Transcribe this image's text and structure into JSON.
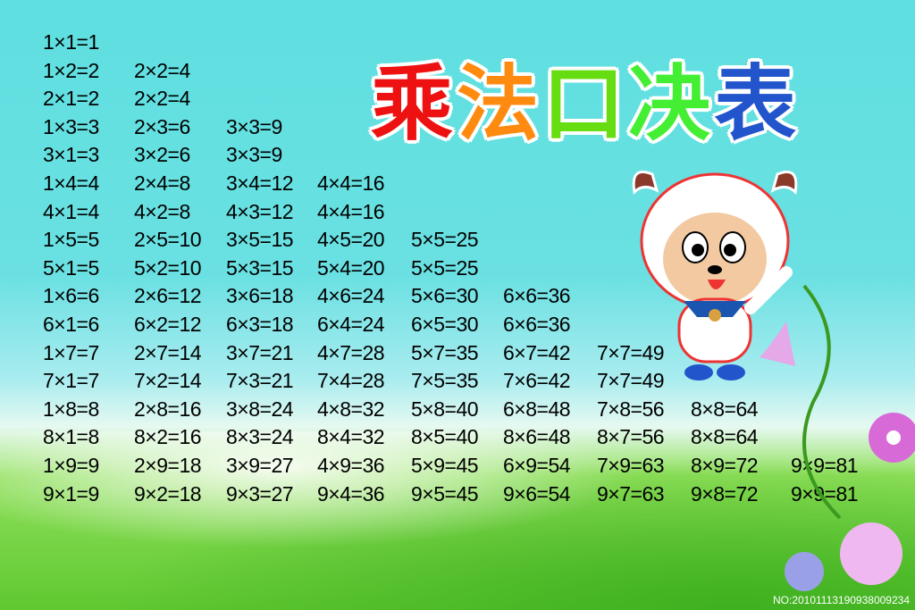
{
  "title": {
    "chars": [
      "乘",
      "法",
      "口",
      "决",
      "表"
    ],
    "colors": [
      "#ee1111",
      "#ff8a10",
      "#66dd11",
      "#44ee33",
      "#2255cc"
    ]
  },
  "table": [
    [
      "1×1=1"
    ],
    [
      "1×2=2",
      "2×2=4"
    ],
    [
      "2×1=2",
      "2×2=4"
    ],
    [
      "1×3=3",
      "2×3=6",
      "3×3=9"
    ],
    [
      "3×1=3",
      "3×2=6",
      "3×3=9"
    ],
    [
      "1×4=4",
      "2×4=8",
      "3×4=12",
      "4×4=16"
    ],
    [
      "4×1=4",
      "4×2=8",
      "4×3=12",
      "4×4=16"
    ],
    [
      "1×5=5",
      "2×5=10",
      "3×5=15",
      "4×5=20",
      "5×5=25"
    ],
    [
      "5×1=5",
      "5×2=10",
      "5×3=15",
      "5×4=20",
      "5×5=25"
    ],
    [
      "1×6=6",
      "2×6=12",
      "3×6=18",
      "4×6=24",
      "5×6=30",
      "6×6=36"
    ],
    [
      "6×1=6",
      "6×2=12",
      "6×3=18",
      "6×4=24",
      "6×5=30",
      "6×6=36"
    ],
    [
      "1×7=7",
      "2×7=14",
      "3×7=21",
      "4×7=28",
      "5×7=35",
      "6×7=42",
      "7×7=49"
    ],
    [
      "7×1=7",
      "7×2=14",
      "7×3=21",
      "7×4=28",
      "7×5=35",
      "7×6=42",
      "7×7=49"
    ],
    [
      "1×8=8",
      "2×8=16",
      "3×8=24",
      "4×8=32",
      "5×8=40",
      "6×8=48",
      "7×8=56",
      "8×8=64"
    ],
    [
      "8×1=8",
      "8×2=16",
      "8×3=24",
      "8×4=32",
      "8×5=40",
      "8×6=48",
      "8×7=56",
      "8×8=64"
    ],
    [
      "1×9=9",
      "2×9=18",
      "3×9=27",
      "4×9=36",
      "5×9=45",
      "6×9=54",
      "7×9=63",
      "8×9=72",
      "9×9=81"
    ],
    [
      "9×1=9",
      "9×2=18",
      "9×3=27",
      "9×4=36",
      "9×5=45",
      "9×6=54",
      "9×7=63",
      "9×8=72",
      "9×9=81"
    ]
  ],
  "serial": "NO:20101113190938009234"
}
